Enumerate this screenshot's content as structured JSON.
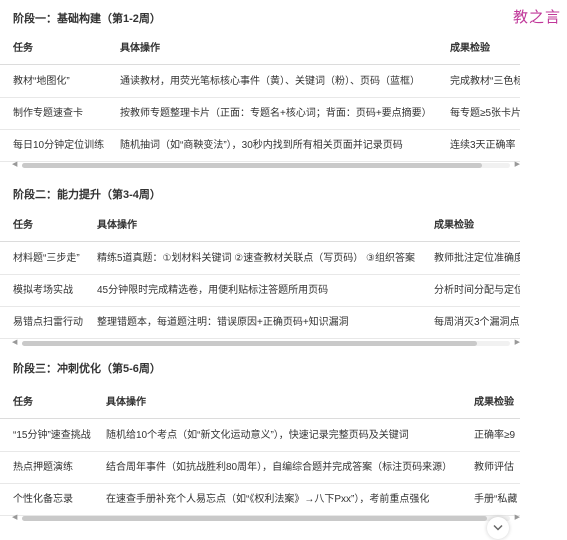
{
  "logo": "教之言",
  "colors": {
    "logo": "#c0389a"
  },
  "sections": [
    {
      "title": "阶段一：基础构建（第1-2周）",
      "headers": [
        "任务",
        "具体操作",
        "成果检验"
      ],
      "rows": [
        [
          "教材“地图化”",
          "通读教材，用荧光笔标核心事件（黄）、关键词（粉）、页码（蓝框）",
          "完成教材“三色标注"
        ],
        [
          "制作专题速查卡",
          "按教师专题整理卡片（正面：专题名+核心词；背面：页码+要点摘要）",
          "每专题≥5张卡片"
        ],
        [
          "每日10分钟定位训练",
          "随机抽词（如“商鞅变法”），30秒内找到所有相关页面并记录页码",
          "连续3天正确率"
        ]
      ]
    },
    {
      "title": "阶段二：能力提升（第3-4周）",
      "headers": [
        "任务",
        "具体操作",
        "成果检验"
      ],
      "rows": [
        [
          "材料题“三步走”",
          "精练5道真题：①划材料关键词 ②速查教材关联点（写页码） ③组织答案",
          "教师批注定位准确度"
        ],
        [
          "模拟考场实战",
          "45分钟限时完成精选卷，用便利贴标注答题所用页码",
          "分析时间分配与定位"
        ],
        [
          "易错点扫雷行动",
          "整理错题本，每道题注明：错误原因+正确页码+知识漏洞",
          "每周消灭3个漏洞点"
        ]
      ]
    },
    {
      "title": "阶段三：冲刺优化（第5-6周）",
      "headers": [
        "任务",
        "具体操作",
        "成果检验"
      ],
      "rows": [
        [
          "“15分钟”速查挑战",
          "随机给10个考点（如“新文化运动意义”），快速记录完整页码及关键词",
          "正确率≥9"
        ],
        [
          "热点押题演练",
          "结合周年事件（如抗战胜利80周年），自编综合题并完成答案（标注页码来源）",
          "教师评估"
        ],
        [
          "个性化备忘录",
          "在速查手册补充个人易忘点（如“《权利法案》→八下Pxx”），考前重点强化",
          "手册“私藏"
        ]
      ]
    }
  ]
}
